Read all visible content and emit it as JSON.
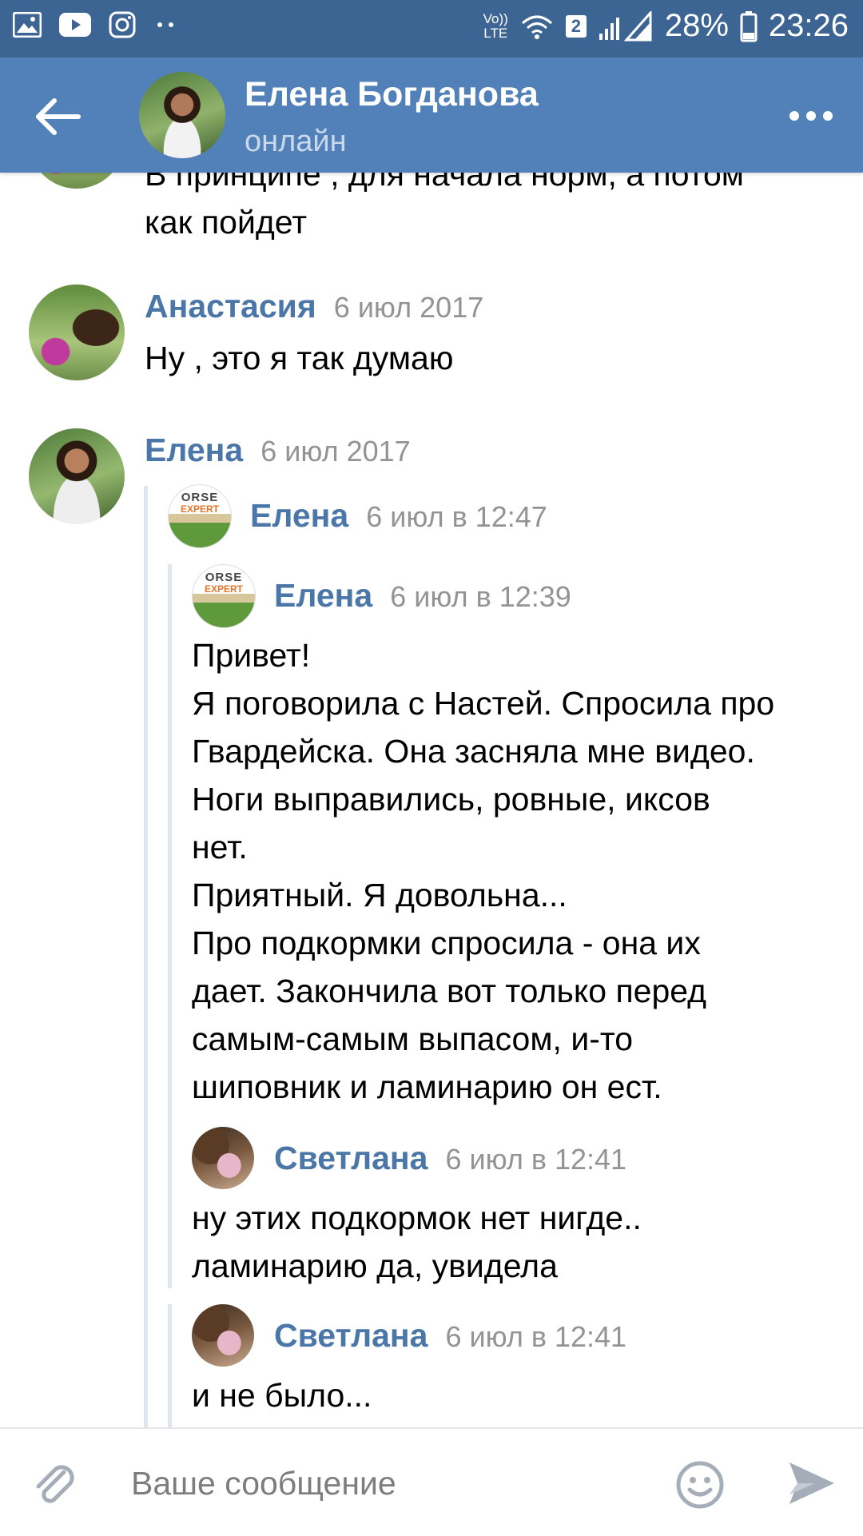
{
  "status_bar": {
    "volte_top": "Vo))",
    "volte_bottom": "LTE",
    "sim_badge": "2",
    "battery": "28%",
    "time": "23:26",
    "icons": [
      "gallery-icon",
      "youtube-icon",
      "instagram-icon",
      "more-notifications-icon",
      "wifi-icon",
      "signal-icon",
      "battery-icon"
    ]
  },
  "header": {
    "contact_name": "Елена Богданова",
    "contact_status": "онлайн",
    "back_icon": "arrow-left-icon",
    "more_icon": "more-horizontal-icon"
  },
  "messages": {
    "partial_top": {
      "text": "В принципе , для начала норм, а потом\nкак пойдет"
    },
    "anastasia": {
      "author": "Анастасия",
      "date": "6 июл 2017",
      "text": "Ну , это я так думаю"
    },
    "elena": {
      "author": "Елена",
      "date": "6 июл 2017",
      "forward_1": {
        "author": "Елена",
        "date": "6 июл в 12:47",
        "avatar_text_1": "ORSE",
        "avatar_text_2": "EXPERT",
        "nested": {
          "author": "Елена",
          "date": "6 июл в 12:39",
          "text": "Привет!\nЯ поговорила с Настей. Спросила про\nГвардейска. Она засняла мне видео.\nНоги выправились, ровные, иксов\nнет.\nПриятный. Я довольна...\nПро подкормки спросила - она их\nдает. Закончила вот только перед\nсамым-самым выпасом, и-то\nшиповник и ламинарию он ест."
        }
      },
      "forward_2": {
        "author": "Светлана",
        "date": "6 июл в 12:41",
        "text": "ну этих подкормок нет нигде..\nламинарию да, увидела"
      },
      "forward_3": {
        "author": "Светлана",
        "date": "6 июл в 12:41",
        "text": "и не было..."
      }
    }
  },
  "composer": {
    "placeholder": "Ваше сообщение",
    "attach_icon": "paperclip-icon",
    "emoji_icon": "smiley-icon",
    "send_icon": "send-icon"
  },
  "colors": {
    "status_bar": "#3d6593",
    "header": "#5181b8",
    "author_link": "#4a76a8",
    "date_text": "#939393",
    "quote_line": "#dfe6ee"
  }
}
